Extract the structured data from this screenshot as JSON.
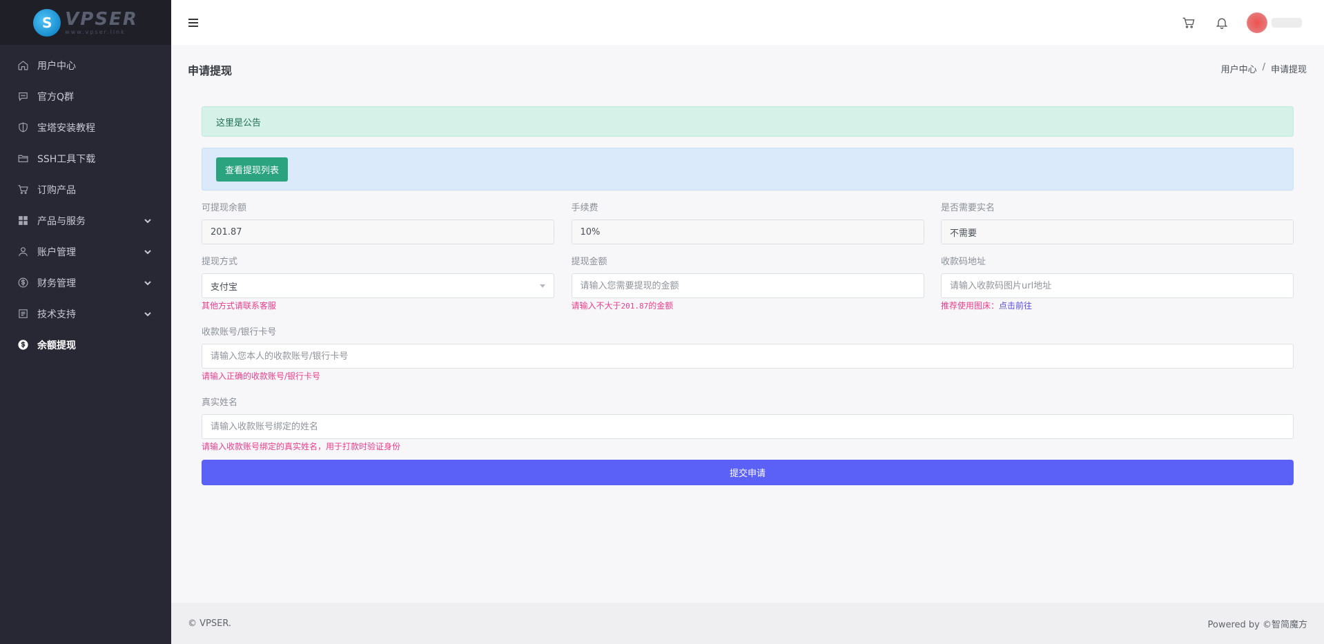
{
  "brand": {
    "name": "VPSER",
    "subtitle": "www.vpser.link",
    "mark": "S"
  },
  "sidebar": {
    "items": [
      {
        "label": "用户中心",
        "icon": "home-icon",
        "expandable": false
      },
      {
        "label": "官方Q群",
        "icon": "chat-icon",
        "expandable": false
      },
      {
        "label": "宝塔安装教程",
        "icon": "shield-icon",
        "expandable": false
      },
      {
        "label": "SSH工具下载",
        "icon": "folder-icon",
        "expandable": false
      },
      {
        "label": "订购产品",
        "icon": "cart-icon",
        "expandable": false
      },
      {
        "label": "产品与服务",
        "icon": "grid-icon",
        "expandable": true
      },
      {
        "label": "账户管理",
        "icon": "user-icon",
        "expandable": true
      },
      {
        "label": "财务管理",
        "icon": "dollar-icon",
        "expandable": true
      },
      {
        "label": "技术支持",
        "icon": "list-icon",
        "expandable": true
      },
      {
        "label": "余额提现",
        "icon": "dollar-icon",
        "expandable": false,
        "active": true
      }
    ]
  },
  "topbar": {
    "menu_icon": "hamburger-icon",
    "cart_icon": "cart-icon",
    "bell_icon": "bell-icon"
  },
  "page": {
    "title": "申请提现",
    "breadcrumb": [
      "用户中心",
      "申请提现"
    ]
  },
  "notice": "这里是公告",
  "view_list_button": "查看提现列表",
  "form": {
    "balance": {
      "label": "可提现余额",
      "value": "201.87"
    },
    "fee": {
      "label": "手续费",
      "value": "10%"
    },
    "realname_required": {
      "label": "是否需要实名",
      "value": "不需要"
    },
    "method": {
      "label": "提现方式",
      "value": "支付宝",
      "help": "其他方式请联系客服"
    },
    "amount": {
      "label": "提现金额",
      "placeholder": "请输入您需要提现的金额",
      "help_prefix": "请输入不大于",
      "help_value": "201.87",
      "help_suffix": "的金额"
    },
    "qr_url": {
      "label": "收款码地址",
      "placeholder": "请输入收款码图片url地址",
      "help_prefix": "推荐使用图床：",
      "help_link": "点击前往"
    },
    "account": {
      "label": "收款账号/银行卡号",
      "placeholder": "请输入您本人的收款账号/银行卡号",
      "help": "请输入正确的收款账号/银行卡号"
    },
    "name": {
      "label": "真实姓名",
      "placeholder": "请输入收款账号绑定的姓名",
      "help": "请输入收款账号绑定的真实姓名，用于打款时验证身份"
    },
    "submit": "提交申请"
  },
  "footer": {
    "left": "© VPSER.",
    "right": "Powered by ©智简魔方"
  }
}
